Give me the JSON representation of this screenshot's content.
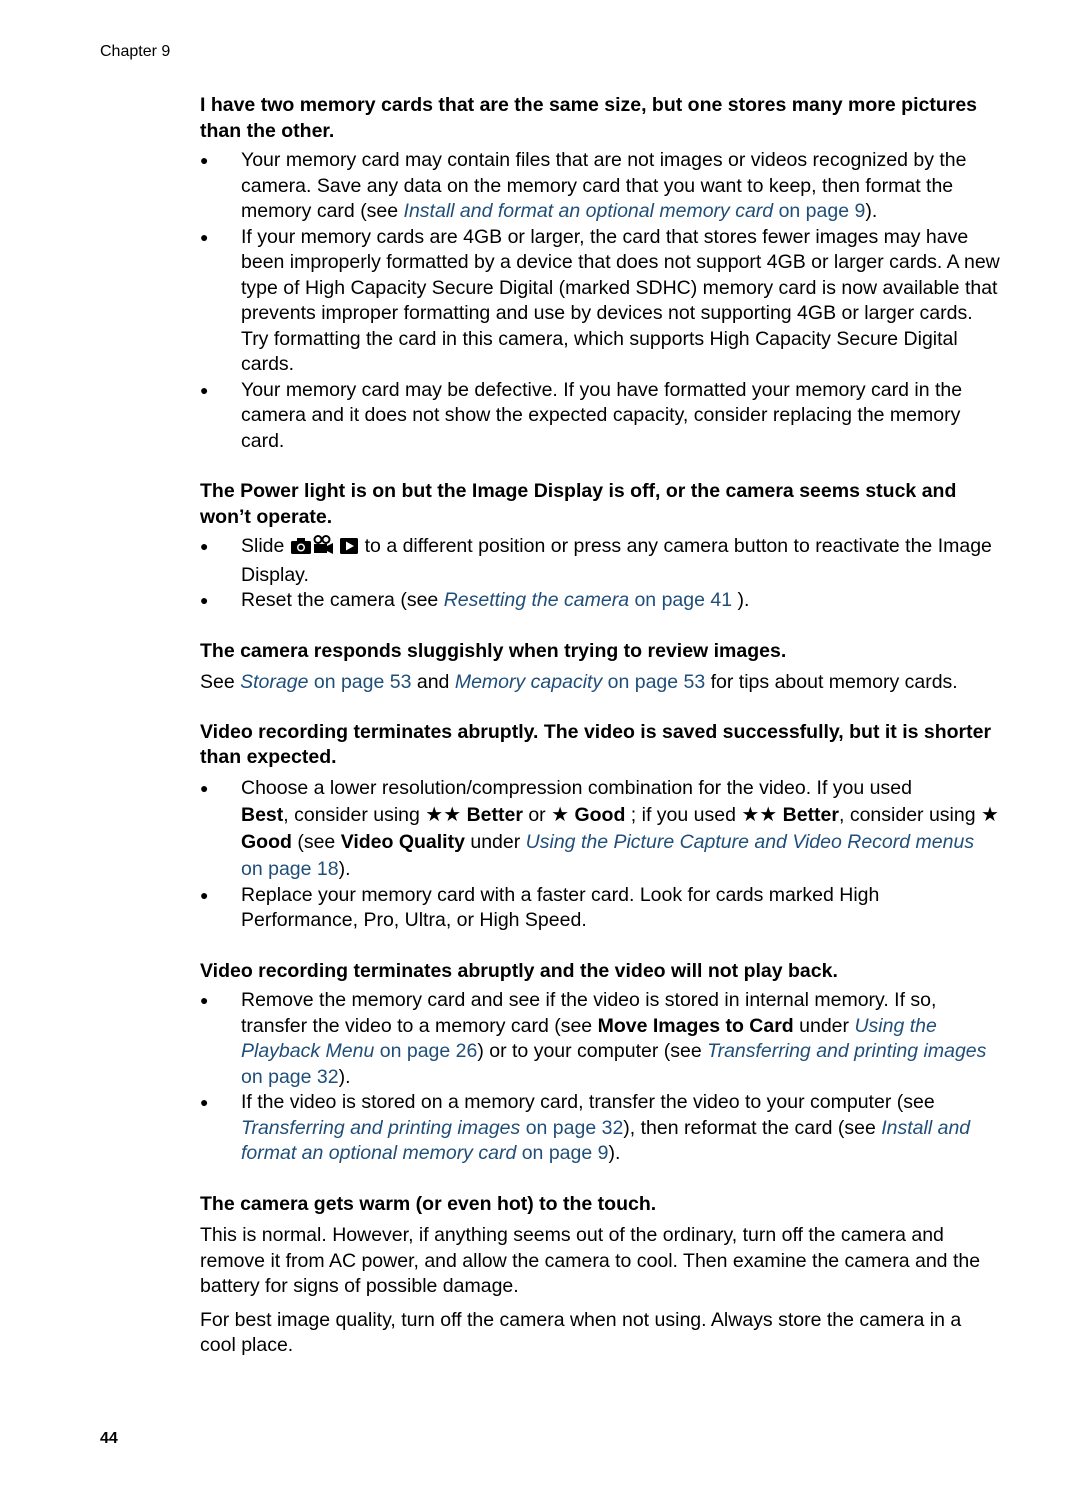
{
  "header": {
    "chapter": "Chapter 9"
  },
  "footer": {
    "page_number": "44"
  },
  "colors": {
    "link": "#1f4e79",
    "text": "#000000"
  },
  "sections": [
    {
      "heading": "I have two memory cards that are the same size, but one stores many more pictures than the other.",
      "bullets": [
        {
          "pre": "Your memory card may contain files that are not images or videos recognized by the camera. Save any data on the memory card that you want to keep, then format the memory card (see ",
          "link_title": "Install and format an optional memory card",
          "link_page": " on page 9",
          "post": ")."
        },
        {
          "text": "If your memory cards are 4GB or larger, the card that stores fewer images may have been improperly formatted by a device that does not support 4GB or larger cards. A new type of High Capacity Secure Digital (marked SDHC) memory card is now available that prevents improper formatting and use by devices not supporting 4GB or larger cards. Try formatting the card in this camera, which supports High Capacity Secure Digital cards."
        },
        {
          "text": "Your memory card may be defective. If you have formatted your memory card in the camera and it does not show the expected capacity, consider replacing the memory card."
        }
      ]
    },
    {
      "heading": "The Power light is on but the Image Display is off, or the camera seems stuck and won’t operate.",
      "bullets": [
        {
          "pre": "Slide",
          "icons": [
            "camera-icon",
            "video-camera-icon",
            "playback-icon"
          ],
          "post": " to a different position or press any camera button to reactivate the Image Display."
        },
        {
          "pre": "Reset the camera (see ",
          "link_title": "Resetting the camera",
          "link_page": " on page 41",
          "post": " )."
        }
      ]
    },
    {
      "heading": "The camera responds sluggishly when trying to review images.",
      "paragraph": {
        "pre": "See ",
        "link1_title": "Storage",
        "link1_page": " on page 53",
        "mid": " and ",
        "link2_title": "Memory capacity",
        "link2_page": " on page 53",
        "post": " for tips about memory cards."
      }
    },
    {
      "heading": "Video recording terminates abruptly. The video is saved successfully, but it is shorter than expected.",
      "bullets": [
        {
          "line1": "Choose a lower resolution/compression combination for the video. If you used",
          "best": "Best",
          "t1": ", consider using ",
          "better": "Better",
          "t2": " or ",
          "good": "Good",
          "t3": " ; if you used ",
          "better2": "Better",
          "t4": ", consider using ",
          "good2": "Good",
          "t5": " (see ",
          "video_quality": "Video Quality",
          "t6": " under ",
          "link_title": "Using the Picture Capture and Video Record menus",
          "link_page": " on page 18",
          "post": ")."
        },
        {
          "text": "Replace your memory card with a faster card. Look for cards marked High Performance, Pro, Ultra, or High Speed."
        }
      ]
    },
    {
      "heading": "Video recording terminates abruptly and the video will not play back.",
      "bullets": [
        {
          "pre": "Remove the memory card and see if the video is stored in internal memory. If so, transfer the video to a memory card (see ",
          "bold": " Move Images to Card",
          "mid": " under ",
          "link1_title": "Using the Playback Menu",
          "link1_page": " on page 26",
          "mid2": ") or to your computer (see ",
          "link2_title": "Transferring and printing images",
          "link2_page": " on page 32",
          "post": ")."
        },
        {
          "pre": "If the video is stored on a memory card, transfer the video to your computer (see ",
          "link1_title": "Transferring and printing images",
          "link1_page": " on page 32",
          "mid": "), then reformat the card (see ",
          "link2_title": "Install and format an optional memory card",
          "link2_page": " on page 9",
          "post": ")."
        }
      ]
    },
    {
      "heading": "The camera gets warm (or even hot) to the touch.",
      "paragraphs": [
        "This is normal. However, if anything seems out of the ordinary, turn off the camera and remove it from AC power, and allow the camera to cool. Then examine the camera and the battery for signs of possible damage.",
        "For best image quality, turn off the camera when not using. Always store the camera in a cool place."
      ]
    }
  ]
}
